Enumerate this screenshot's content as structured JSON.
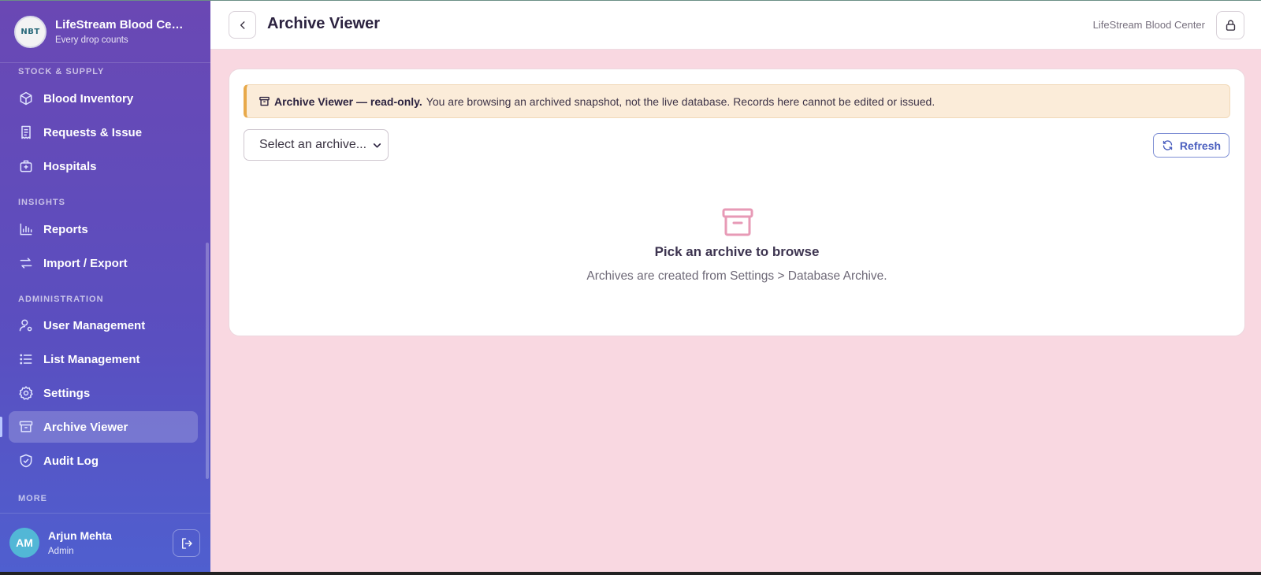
{
  "brand": {
    "logo_text": "NBT",
    "name": "LifeStream Blood Center",
    "tagline": "Every drop counts"
  },
  "sidebar": {
    "sections": {
      "stock": "STOCK & SUPPLY",
      "insights": "INSIGHTS",
      "admin": "ADMINISTRATION",
      "more": "MORE"
    },
    "items": {
      "inventory": "Blood Inventory",
      "requests": "Requests & Issue",
      "hospitals": "Hospitals",
      "reports": "Reports",
      "import_export": "Import / Export",
      "users": "User Management",
      "lists": "List Management",
      "settings": "Settings",
      "archive": "Archive Viewer",
      "audit": "Audit Log"
    },
    "active_item": "archive"
  },
  "user": {
    "initials": "AM",
    "name": "Arjun Mehta",
    "role": "Admin"
  },
  "header": {
    "title": "Archive Viewer",
    "org": "LifeStream Blood Center"
  },
  "notice": {
    "bold": "Archive Viewer — read-only.",
    "text": "You are browsing an archived snapshot, not the live database. Records here cannot be edited or issued."
  },
  "archive_select": {
    "value": "Select an archive..."
  },
  "refresh_label": "Refresh",
  "empty_state": {
    "title": "Pick an archive to browse",
    "subtitle": "Archives are created from Settings > Database Archive."
  },
  "colors": {
    "sidebar_top": "#6a48b4",
    "sidebar_bottom": "#4f5fcf",
    "main_bg": "#f9d8e1",
    "notice_bg": "#fbecd9",
    "notice_accent": "#e8a94a",
    "refresh_accent": "#4b5fbf",
    "empty_icon": "#e79ab6"
  }
}
